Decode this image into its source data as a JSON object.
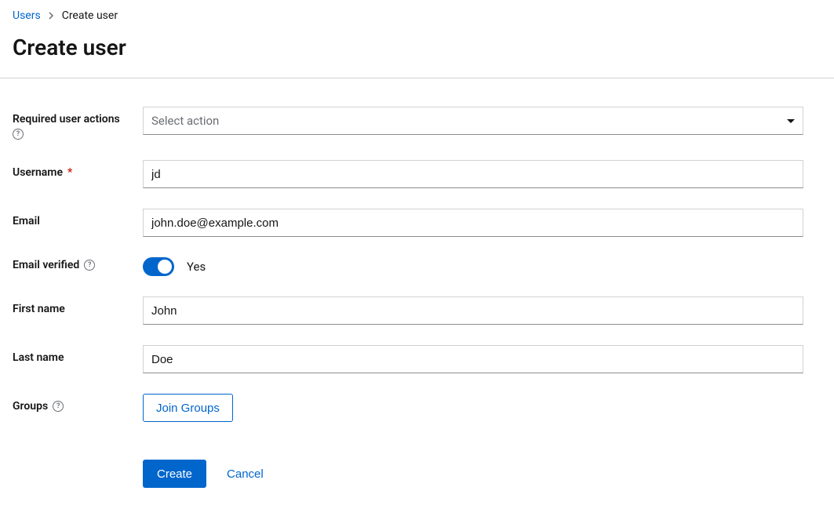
{
  "breadcrumb": {
    "parent": "Users",
    "current": "Create user"
  },
  "page": {
    "title": "Create user"
  },
  "form": {
    "required_actions": {
      "label": "Required user actions",
      "placeholder": "Select action"
    },
    "username": {
      "label": "Username",
      "value": "jd"
    },
    "email": {
      "label": "Email",
      "value": "john.doe@example.com"
    },
    "email_verified": {
      "label": "Email verified",
      "state_label": "Yes",
      "value": true
    },
    "first_name": {
      "label": "First name",
      "value": "John"
    },
    "last_name": {
      "label": "Last name",
      "value": "Doe"
    },
    "groups": {
      "label": "Groups",
      "button_label": "Join Groups"
    }
  },
  "actions": {
    "create": "Create",
    "cancel": "Cancel"
  }
}
